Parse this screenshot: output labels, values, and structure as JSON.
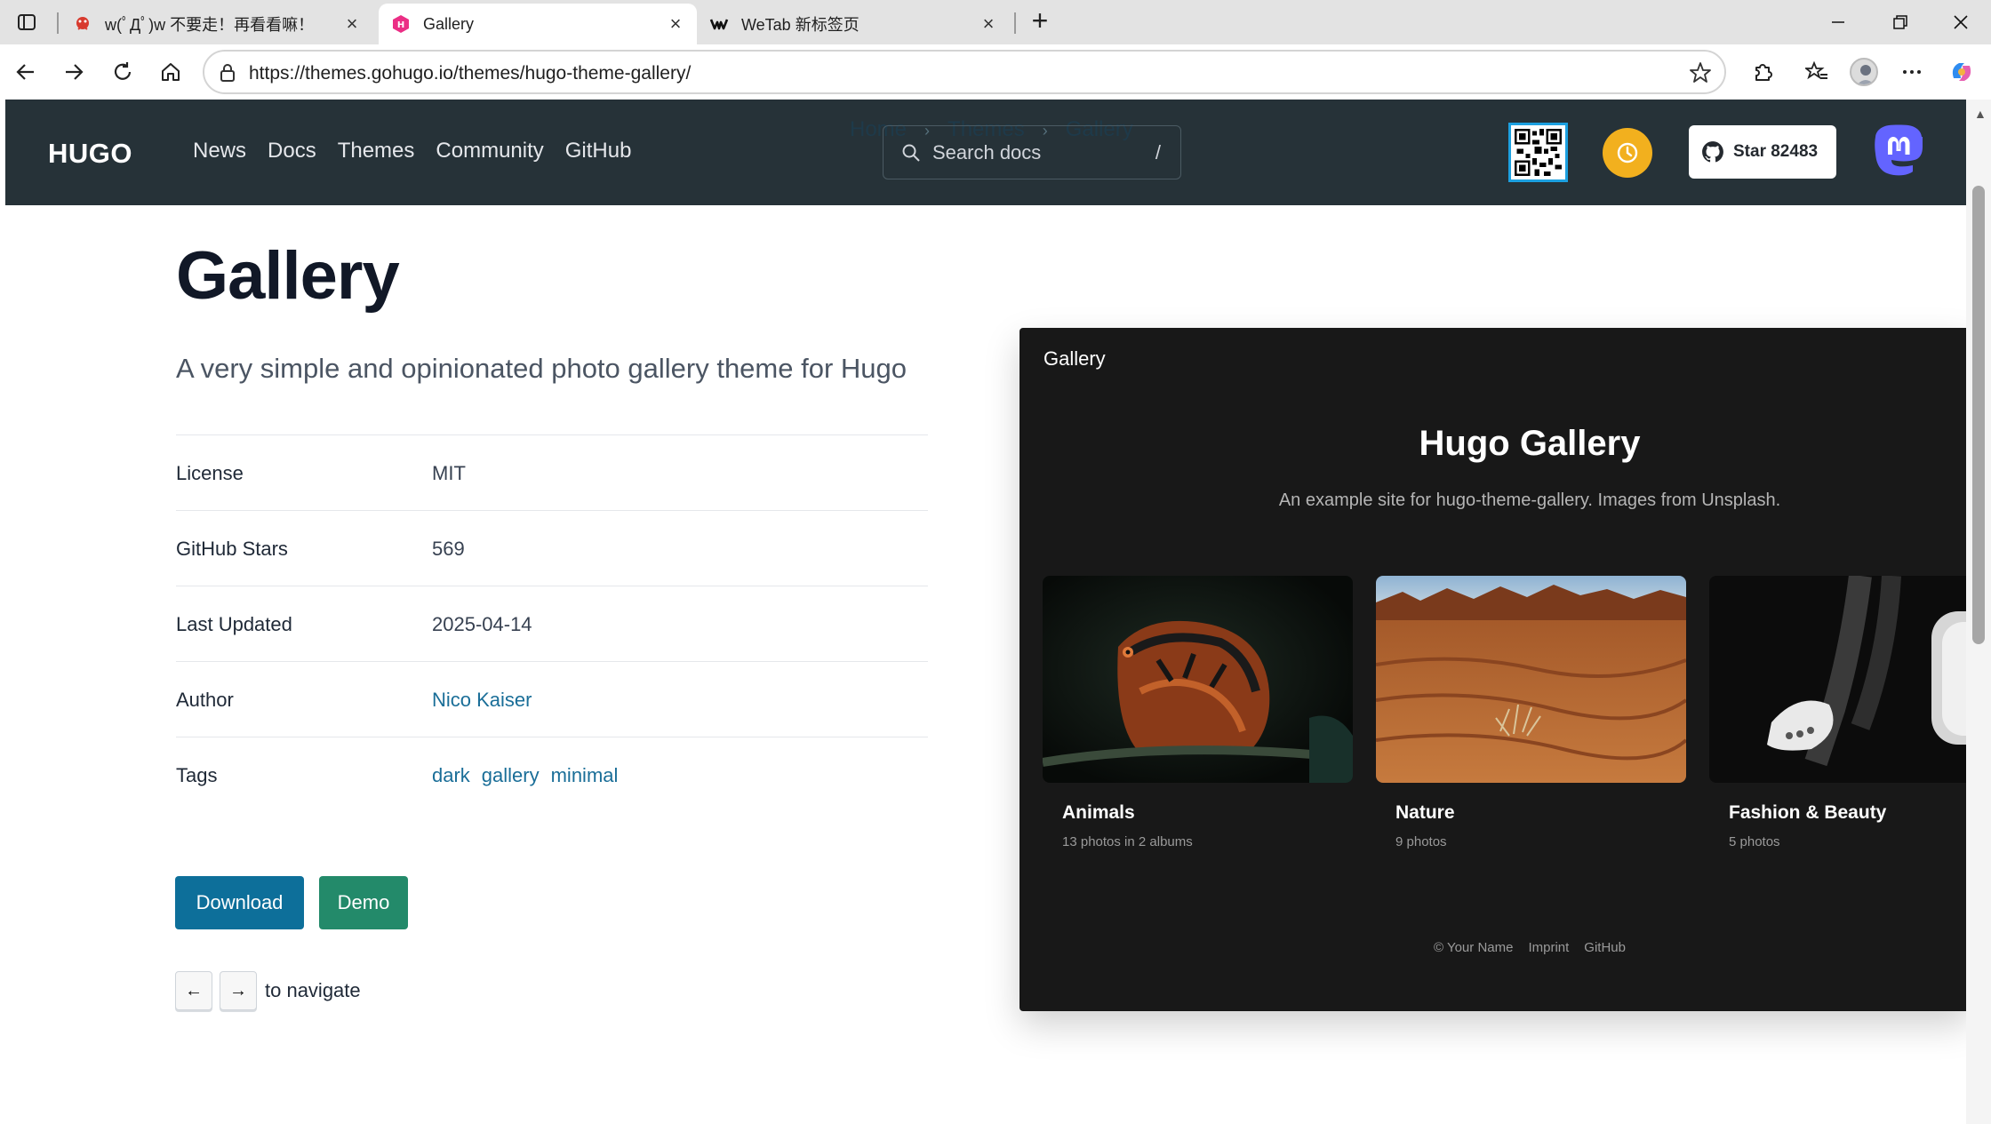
{
  "browser": {
    "tabs": [
      {
        "title": "w(ﾟДﾟ)w 不要走！再看看嘛！",
        "favicon": "red-bug-icon",
        "active": false
      },
      {
        "title": "Gallery",
        "favicon": "hugo-icon",
        "active": true
      },
      {
        "title": "WeTab 新标签页",
        "favicon": "wetab-icon",
        "active": false
      }
    ],
    "new_tab": "+",
    "url": "https://themes.gohugo.io/themes/hugo-theme-gallery/"
  },
  "site": {
    "logo": "HUGO",
    "nav": [
      "News",
      "Docs",
      "Themes",
      "Community",
      "GitHub"
    ],
    "breadcrumb": [
      "Home",
      "Themes",
      "Gallery"
    ],
    "breadcrumb_sep": "›",
    "search_placeholder": "Search docs",
    "search_shortcut": "/",
    "github_star_label": "Star 82483",
    "accent_yellow": "#f2b01e",
    "header_bg": "#263238"
  },
  "theme": {
    "title": "Gallery",
    "description": "A very simple and opinionated photo gallery theme for Hugo",
    "meta": [
      {
        "key": "License",
        "value": "MIT"
      },
      {
        "key": "GitHub Stars",
        "value": "569"
      },
      {
        "key": "Last Updated",
        "value": "2025-04-14"
      },
      {
        "key": "Author",
        "value": "Nico Kaiser"
      }
    ],
    "tags_label": "Tags",
    "tags": [
      "dark",
      "gallery",
      "minimal"
    ],
    "download_label": "Download",
    "demo_label": "Demo",
    "prev_key": "←",
    "next_key": "→",
    "navigate_hint": "to navigate"
  },
  "preview": {
    "brand": "Gallery",
    "title": "Hugo Gallery",
    "subtitle": "An example site for hugo-theme-gallery. Images from Unsplash.",
    "albums": [
      {
        "name": "Animals",
        "count": "13 photos in 2 albums"
      },
      {
        "name": "Nature",
        "count": "9 photos"
      },
      {
        "name": "Fashion & Beauty",
        "count": "5 photos"
      }
    ],
    "footer": [
      "© Your Name",
      "Imprint",
      "GitHub"
    ]
  }
}
